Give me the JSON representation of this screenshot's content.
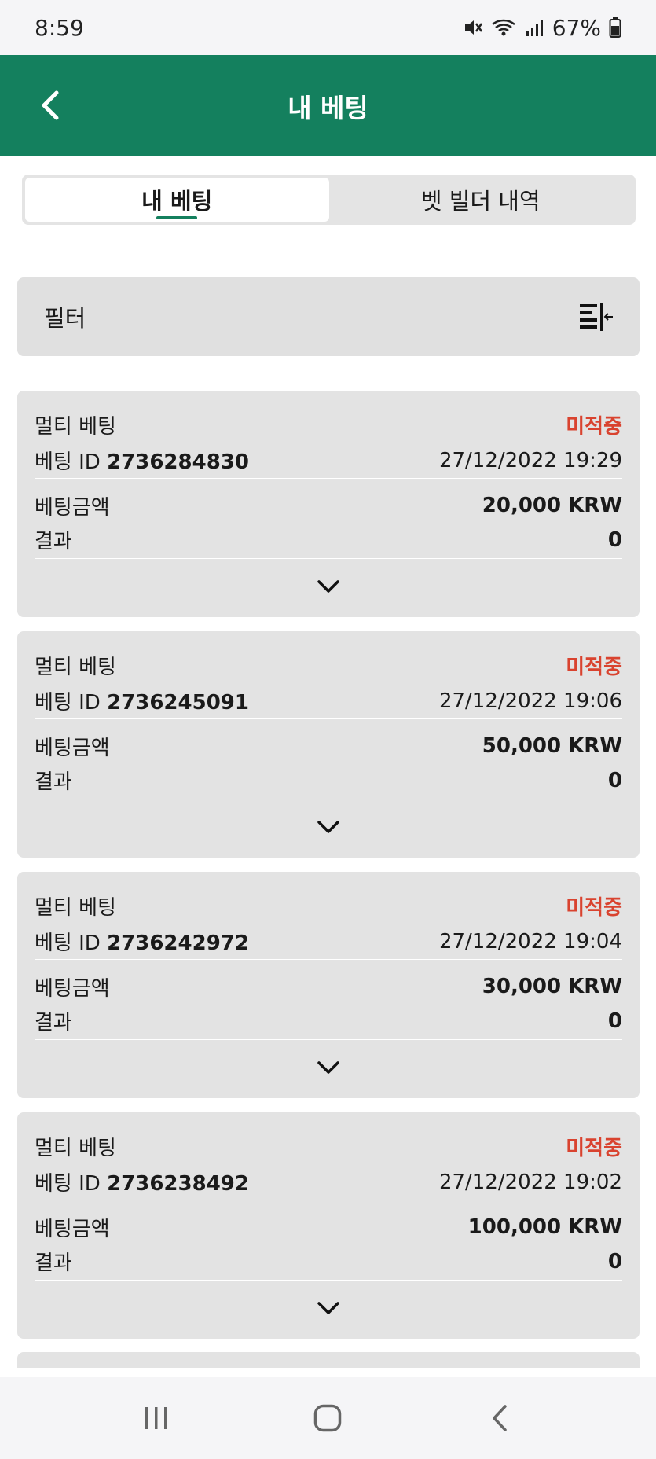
{
  "status_bar": {
    "time": "8:59",
    "battery": "67%"
  },
  "header": {
    "title": "내 베팅"
  },
  "tabs": [
    {
      "label": "내 베팅",
      "active": true
    },
    {
      "label": "벳 빌더 내역",
      "active": false
    }
  ],
  "filter": {
    "label": "필터"
  },
  "colors": {
    "header": "#14805e",
    "status_pending": "#d9432f"
  },
  "bets": [
    {
      "type": "멀티 베팅",
      "status": "미적중",
      "id_label": "베팅 ID",
      "id": "2736284830",
      "datetime": "27/12/2022 19:29",
      "amount_label": "베팅금액",
      "amount": "20,000 KRW",
      "result_label": "결과",
      "result": "0"
    },
    {
      "type": "멀티 베팅",
      "status": "미적중",
      "id_label": "베팅 ID",
      "id": "2736245091",
      "datetime": "27/12/2022 19:06",
      "amount_label": "베팅금액",
      "amount": "50,000 KRW",
      "result_label": "결과",
      "result": "0"
    },
    {
      "type": "멀티 베팅",
      "status": "미적중",
      "id_label": "베팅 ID",
      "id": "2736242972",
      "datetime": "27/12/2022 19:04",
      "amount_label": "베팅금액",
      "amount": "30,000 KRW",
      "result_label": "결과",
      "result": "0"
    },
    {
      "type": "멀티 베팅",
      "status": "미적중",
      "id_label": "베팅 ID",
      "id": "2736238492",
      "datetime": "27/12/2022 19:02",
      "amount_label": "베팅금액",
      "amount": "100,000 KRW",
      "result_label": "결과",
      "result": "0"
    }
  ]
}
